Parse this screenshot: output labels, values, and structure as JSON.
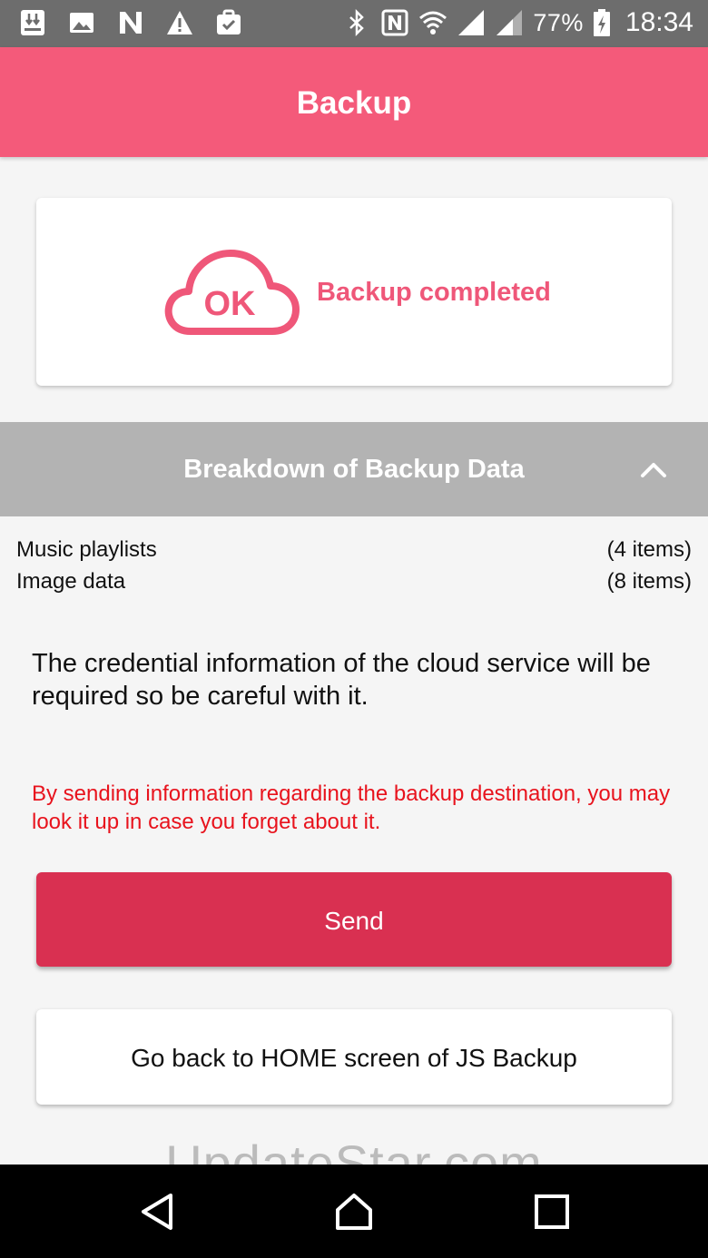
{
  "status_bar": {
    "left_icons": [
      "download-icon",
      "image-icon",
      "n-app-icon",
      "warning-icon",
      "clipboard-icon"
    ],
    "right_icons": [
      "bluetooth-icon",
      "nfc-icon",
      "wifi-icon",
      "signal-icon",
      "signal-secondary-icon"
    ],
    "battery": "77%",
    "time": "18:34"
  },
  "app_bar": {
    "title": "Backup"
  },
  "result_card": {
    "icon_text": "OK",
    "status": "Backup completed"
  },
  "breakdown": {
    "title": "Breakdown of Backup Data",
    "items": [
      {
        "label": "Music playlists",
        "count": "(4 items)"
      },
      {
        "label": "Image data",
        "count": "(8 items)"
      }
    ]
  },
  "notice": "The credential information of the cloud service will be required so be careful with it.",
  "warning": "By sending information regarding the backup destination, you may look it up in case you forget about it.",
  "buttons": {
    "send": "Send",
    "home": "Go back to HOME screen of JS Backup"
  },
  "watermark": "UpdateStar.com",
  "colors": {
    "app_bar": "#f45a7a",
    "accent_text": "#ef5779",
    "send_button": "#d93051",
    "warning_text": "#e8131d",
    "breakdown_header": "#b3b3b3"
  }
}
